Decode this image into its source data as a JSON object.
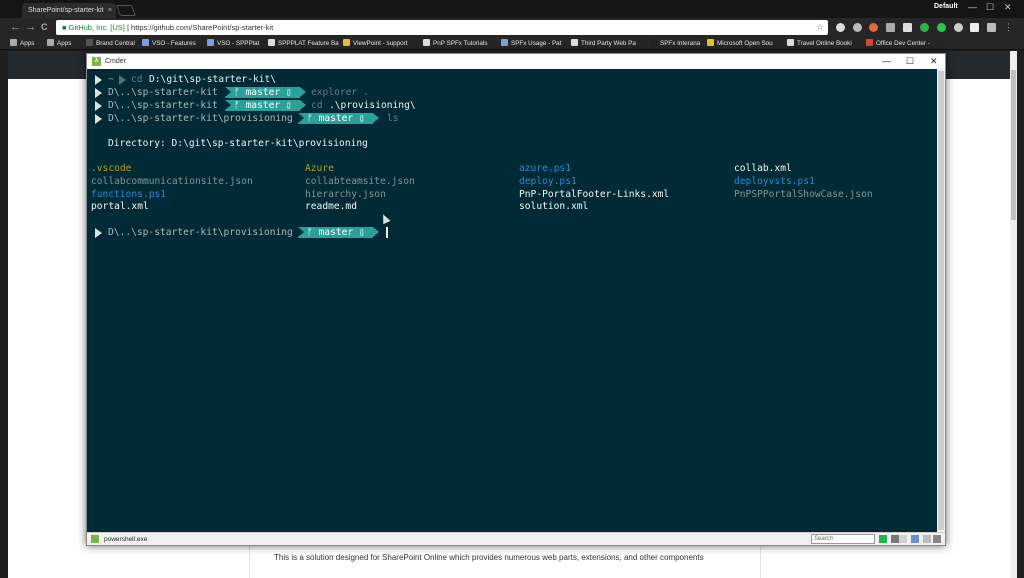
{
  "browser": {
    "tab_title": "SharePoint/sp-starter-kit",
    "tab_close": "×",
    "profile": "Default",
    "secure_label": "GitHub, Inc. [US]",
    "url": "https://github.com/SharePoint/sp-starter-kit",
    "back": "←",
    "forward": "→",
    "reload": "C",
    "minimize": "—",
    "maximize": "☐",
    "close": "✕"
  },
  "bookmarks": [
    "Apps",
    "Apps",
    "Brand Central",
    "VSO - Features",
    "VSO - SPPPlat",
    "SPPPLAT Feature Ba",
    "ViewPoint - support",
    "PnP SPFx Tutorials",
    "SPFx Usage - Pat",
    "Third Party Web Pa",
    "SPFx Interana",
    "Microsoft Open Sou",
    "Travel Online Booki",
    "Office Dev Center -"
  ],
  "cmder": {
    "title": "Cmder",
    "minimize": "—",
    "maximize": "☐",
    "close": "✕"
  },
  "terminal": {
    "prompt1": {
      "tilde": "~",
      "cmd_kw": "cd",
      "cmd_arg": "D:\\git\\sp-starter-kit\\"
    },
    "prompt2": {
      "path": "D\\..\\sp-starter-kit",
      "branch": "ᚠ master ▯",
      "cmd": "explorer ."
    },
    "prompt3": {
      "path": "D\\..\\sp-starter-kit",
      "branch": "ᚠ master ▯",
      "cmd_kw": "cd",
      "cmd_arg": ".\\provisioning\\"
    },
    "prompt4": {
      "path": "D\\..\\sp-starter-kit\\provisioning",
      "branch": "ᚠ master ▯",
      "cmd": "ls"
    },
    "directory": "Directory: D:\\git\\sp-starter-kit\\provisioning",
    "files": {
      "col1": [
        ".vscode",
        "collabcommunicationsite.json",
        "functions.ps1",
        "portal.xml"
      ],
      "col2": [
        "Azure",
        "collabteamsite.json",
        "hierarchy.json",
        "readme.md"
      ],
      "col3": [
        "azure.ps1",
        "deploy.ps1",
        "PnP-PortalFooter-Links.xml",
        "solution.xml"
      ],
      "col4": [
        "collab.xml",
        "deployvsts.ps1",
        "PnPSPPortalShowCase.json"
      ]
    },
    "prompt5": {
      "path": "D\\..\\sp-starter-kit\\provisioning",
      "branch": "ᚠ master ▯"
    }
  },
  "statusbar": {
    "process": "powershell.exe",
    "search_placeholder": "Search"
  },
  "webpage": {
    "description": "This is a solution designed for SharePoint Online which provides numerous web parts, extensions, and other components"
  },
  "colors": {
    "terminal_bg": "#002b36",
    "branch_chip": "#2aa198",
    "folder": "#b5a01a",
    "script": "#268bd2",
    "plain": "#f5f5f5",
    "dim": "#839496"
  }
}
